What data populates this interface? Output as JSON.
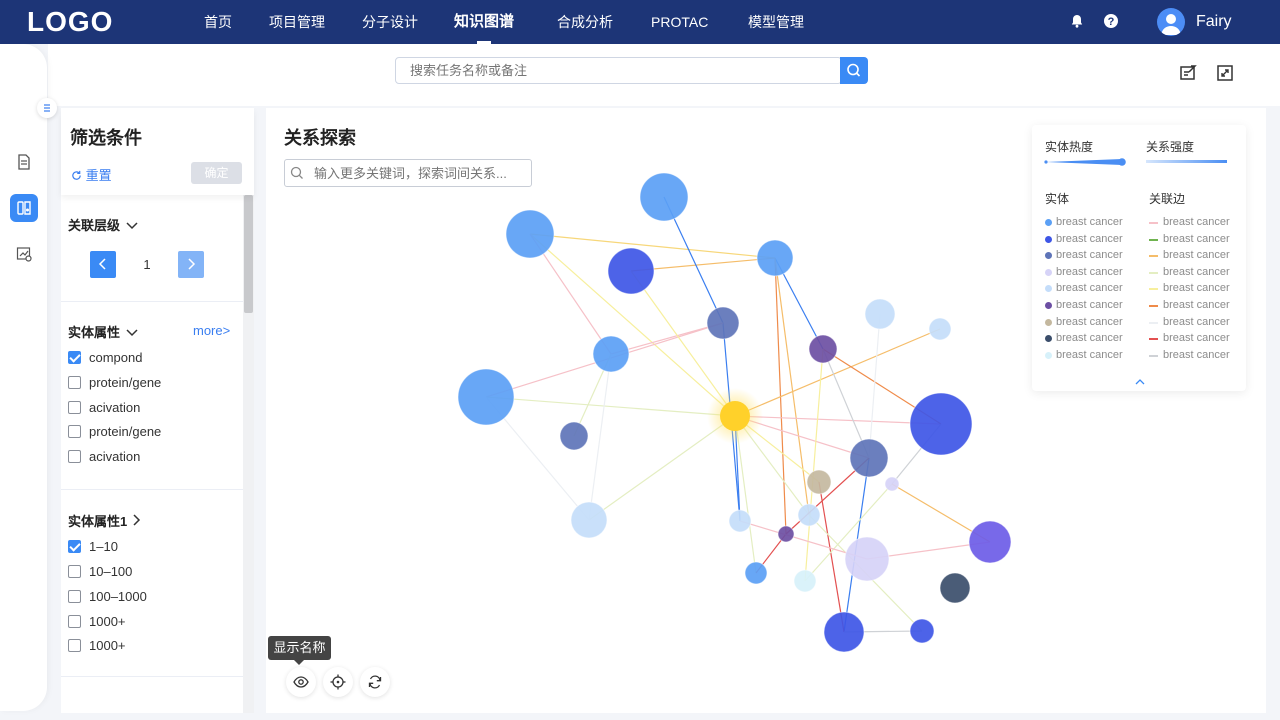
{
  "header": {
    "logo": "LOGO",
    "nav": [
      {
        "label": "首页",
        "active": false
      },
      {
        "label": "项目管理",
        "active": false
      },
      {
        "label": "分子设计",
        "active": false
      },
      {
        "label": "知识图谱",
        "active": true
      },
      {
        "label": "合成分析",
        "active": false
      },
      {
        "label": "PROTAC",
        "active": false
      },
      {
        "label": "模型管理",
        "active": false
      }
    ],
    "username": "Fairy",
    "icons": [
      "bell-icon",
      "help-icon",
      "user-avatar-icon"
    ]
  },
  "search": {
    "placeholder": "搜索任务名称或备注"
  },
  "sidebar": {
    "items": [
      {
        "icon": "document-icon",
        "active": false
      },
      {
        "icon": "knowledge-graph-icon",
        "active": true
      },
      {
        "icon": "chart-report-icon",
        "active": false
      }
    ]
  },
  "filter": {
    "title": "筛选条件",
    "reset_label": "重置",
    "confirm_label": "确定",
    "level": {
      "title": "关联层级",
      "value": "1"
    },
    "entity_attr": {
      "title": "实体属性",
      "more_label": "more>",
      "options": [
        {
          "label": "compond",
          "checked": true
        },
        {
          "label": "protein/gene",
          "checked": false
        },
        {
          "label": "acivation",
          "checked": false
        },
        {
          "label": "protein/gene",
          "checked": false
        },
        {
          "label": "acivation",
          "checked": false
        }
      ]
    },
    "entity_attr1": {
      "title": "实体属性1",
      "options": [
        {
          "label": "1–10",
          "checked": true
        },
        {
          "label": "10–100",
          "checked": false
        },
        {
          "label": "100–1000",
          "checked": false
        },
        {
          "label": "1000+",
          "checked": false
        },
        {
          "label": "1000+",
          "checked": false
        }
      ]
    }
  },
  "main": {
    "title": "关系探索",
    "search_placeholder": "输入更多关键词，探索词间关系..."
  },
  "legend": {
    "heat_label": "实体热度",
    "strength_label": "关系强度",
    "entity_label": "实体",
    "edge_label": "关联边",
    "entities": [
      {
        "label": "breast cancer",
        "color": "#5ba0f5"
      },
      {
        "label": "breast cancer",
        "color": "#3e56e6"
      },
      {
        "label": "breast cancer",
        "color": "#5e74b8"
      },
      {
        "label": "breast cancer",
        "color": "#d6d3f7"
      },
      {
        "label": "breast cancer",
        "color": "#c4ddfa"
      },
      {
        "label": "breast cancer",
        "color": "#6c4fa3"
      },
      {
        "label": "breast cancer",
        "color": "#c4b89f"
      },
      {
        "label": "breast cancer",
        "color": "#3b4e6b"
      },
      {
        "label": "breast cancer",
        "color": "#d7f1fa"
      }
    ],
    "edges": [
      {
        "label": "breast cancer",
        "color": "#f6c1c8"
      },
      {
        "label": "breast cancer",
        "color": "#6fb34f"
      },
      {
        "label": "breast cancer",
        "color": "#f5bd6a"
      },
      {
        "label": "breast cancer",
        "color": "#e4eec2"
      },
      {
        "label": "breast cancer",
        "color": "#f7ef9d"
      },
      {
        "label": "breast cancer",
        "color": "#ef8b4a"
      },
      {
        "label": "breast cancer",
        "color": "#eceff3"
      },
      {
        "label": "breast cancer",
        "color": "#e35050"
      },
      {
        "label": "breast cancer",
        "color": "#cfd2d6"
      }
    ]
  },
  "graph_controls": {
    "tooltip": "显示名称",
    "buttons": [
      "eye-icon",
      "locate-icon",
      "refresh-icon"
    ]
  },
  "colors": {
    "header_bg": "#1d3577",
    "accent": "#3a8af5",
    "highlight_node": "#ffd12a"
  }
}
